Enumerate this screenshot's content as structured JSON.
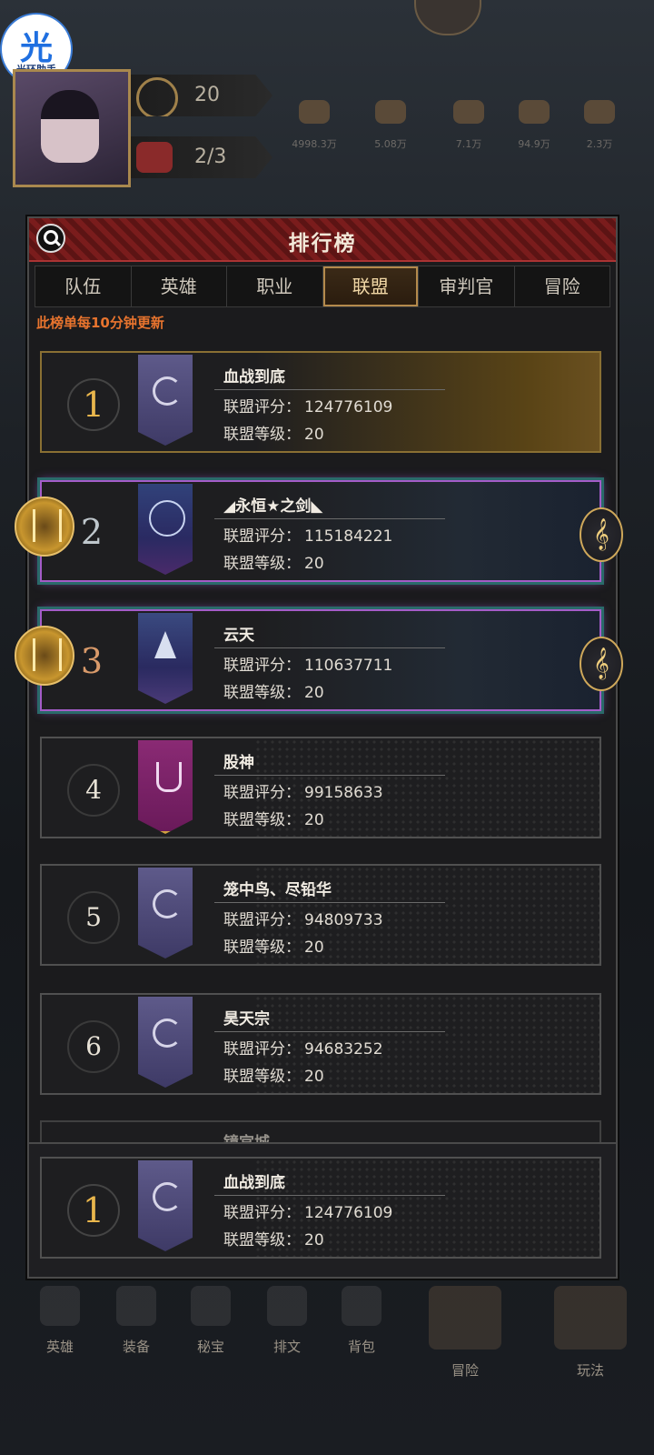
{
  "helper": {
    "glyph": "光",
    "caption": "光环助手"
  },
  "player": {
    "level": "20",
    "stamina": "2/3"
  },
  "resources": [
    "4998.3万",
    "5.08万",
    "7.1万",
    "94.9万",
    "2.3万"
  ],
  "panel": {
    "title": "排行榜",
    "tabs": [
      "队伍",
      "英雄",
      "职业",
      "联盟",
      "审判官",
      "冒险"
    ],
    "active_tab": "联盟",
    "notice": "此榜单每10分钟更新",
    "score_label": "联盟评分：",
    "level_label": "联盟等级：",
    "rows": [
      {
        "rank": "1",
        "name": "血战到底",
        "score": "124776109",
        "level": "20"
      },
      {
        "rank": "2",
        "name": "◢永恒★之剑◣",
        "score": "115184221",
        "level": "20"
      },
      {
        "rank": "3",
        "name": "云天",
        "score": "110637711",
        "level": "20"
      },
      {
        "rank": "4",
        "name": "股神",
        "score": "99158633",
        "level": "20"
      },
      {
        "rank": "5",
        "name": "笼中鸟、尽铅华",
        "score": "94809733",
        "level": "20"
      },
      {
        "rank": "6",
        "name": "昊天宗",
        "score": "94683252",
        "level": "20"
      }
    ],
    "partial_row_name": "镜宫城",
    "self_row": {
      "rank": "1",
      "name": "血战到底",
      "score": "124776109",
      "level": "20"
    }
  },
  "bottom_nav": [
    "英雄",
    "装备",
    "秘宝",
    "排文",
    "背包",
    "冒险",
    "玩法"
  ],
  "icons": {
    "search": "search-icon",
    "lyre": "lyre-icon",
    "clef": "treble-clef-icon"
  },
  "colors": {
    "header_red": "#7a1c1c",
    "notice_orange": "#e8742e",
    "gold": "#e9b64c",
    "purple_frame": "#a45cc8"
  }
}
